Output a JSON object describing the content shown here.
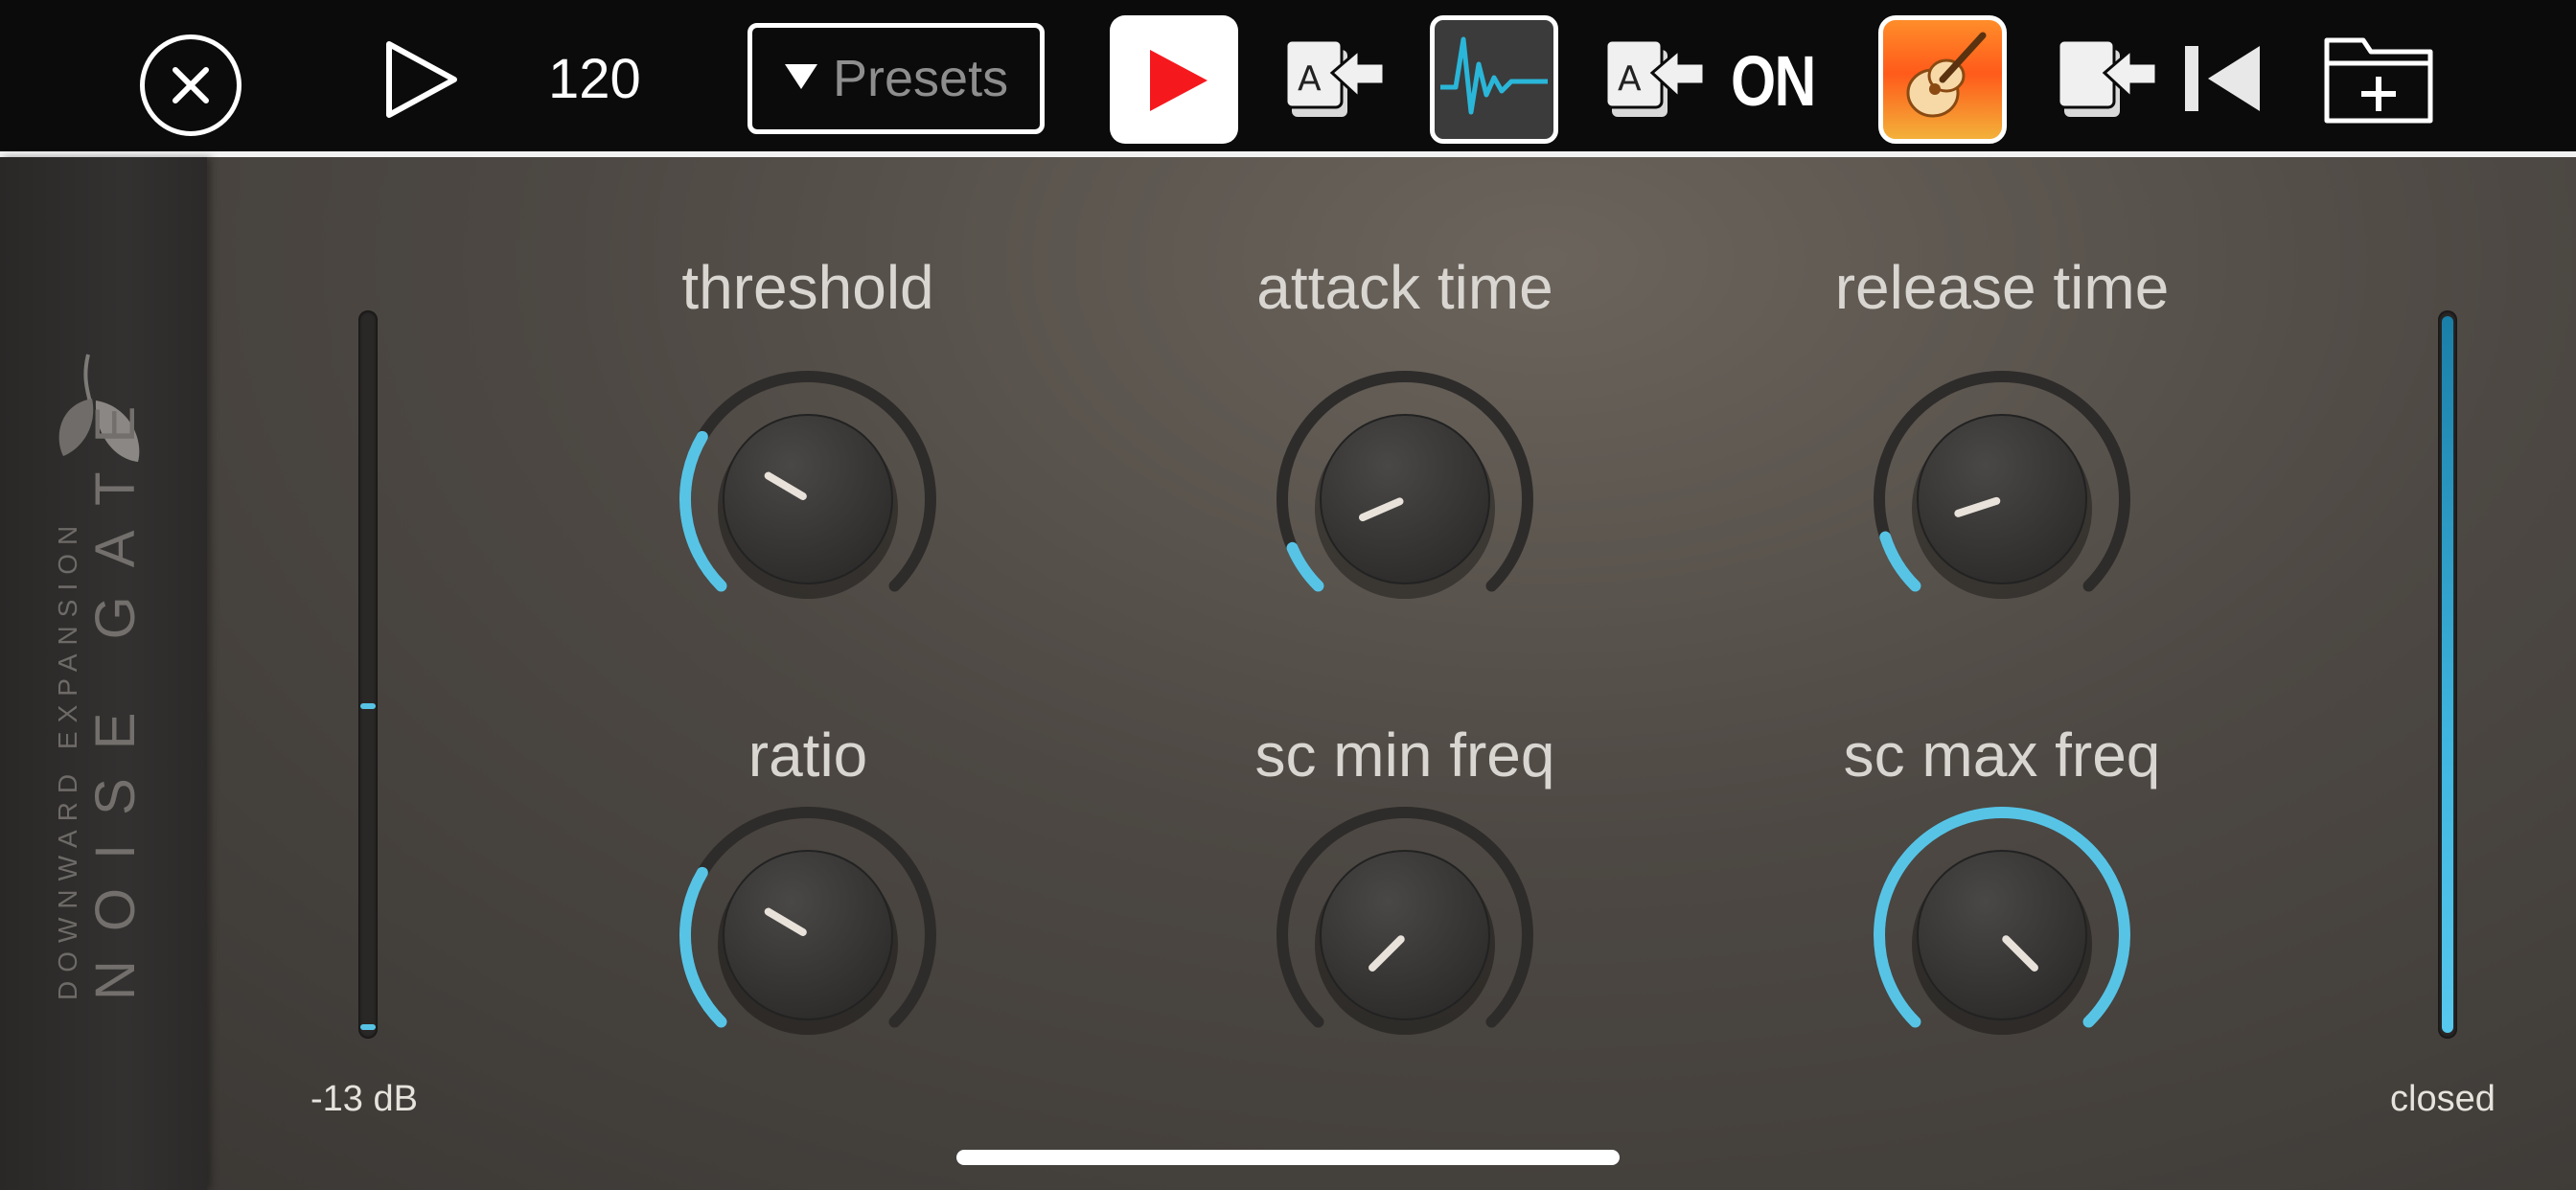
{
  "toolbar": {
    "tempo": "120",
    "presets_label": "Presets",
    "on_label": "ON",
    "icons": [
      "close-icon",
      "play-icon",
      "youtube-icon",
      "copy-a-icon",
      "waveform-icon",
      "copy-a-icon",
      "garageband-icon",
      "copy-icon",
      "rewind-icon",
      "new-folder-icon"
    ]
  },
  "plugin": {
    "brand_sub": "DOWNWARD EXPANSION",
    "brand_main": "NOISE GATE",
    "input_level": "-13 dB",
    "gate_state": "closed",
    "accent_color": "#57c4e6",
    "knobs": [
      {
        "label": "threshold",
        "value": 0.28
      },
      {
        "label": "attack time",
        "value": 0.08
      },
      {
        "label": "release time",
        "value": 0.1
      },
      {
        "label": "ratio",
        "value": 0.28
      },
      {
        "label": "sc min freq",
        "value": 0.0
      },
      {
        "label": "sc max freq",
        "value": 1.0
      }
    ]
  }
}
